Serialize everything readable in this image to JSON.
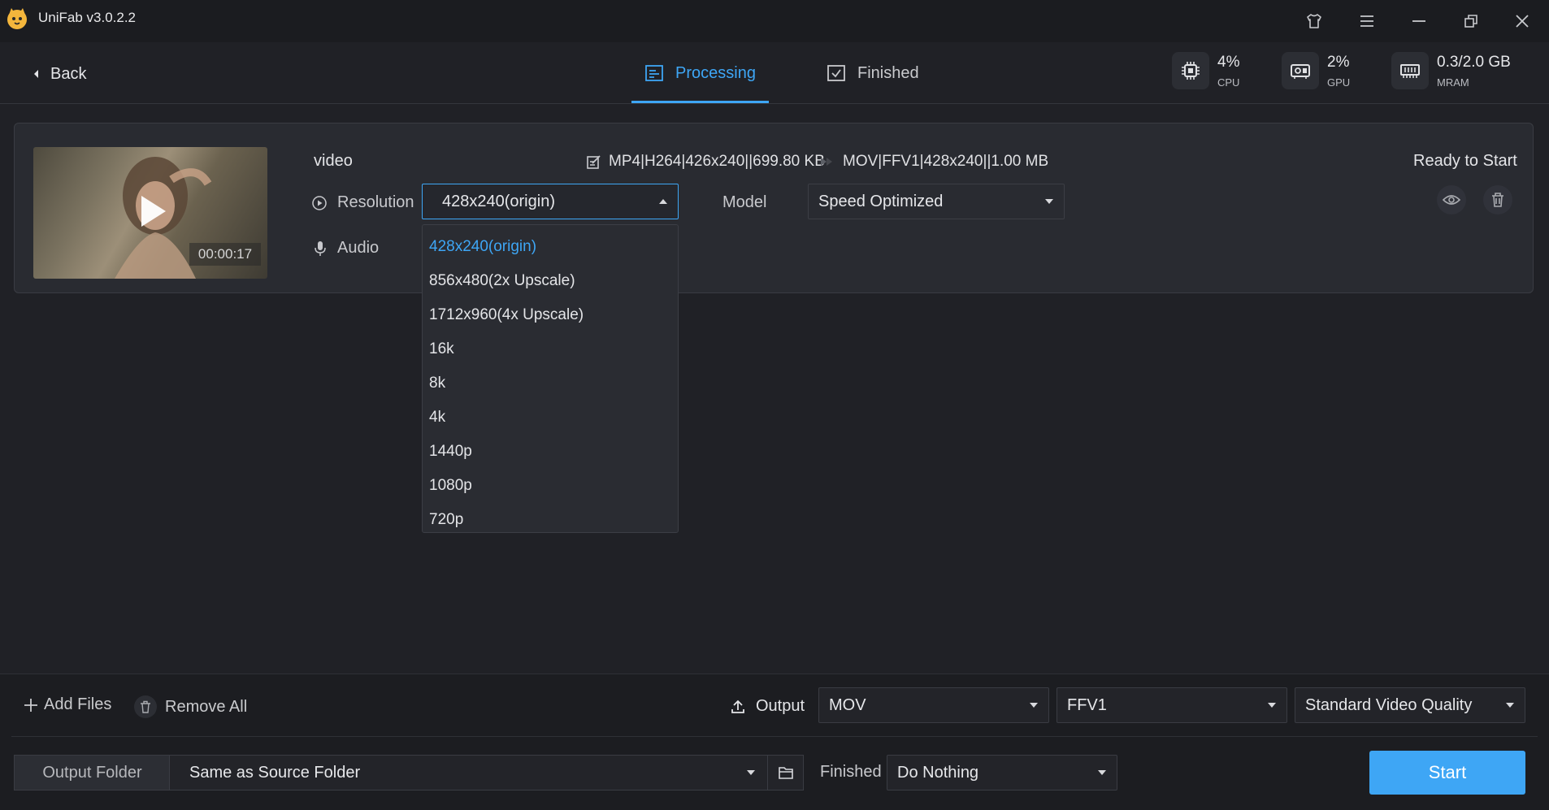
{
  "app": {
    "title": "UniFab v3.0.2.2"
  },
  "header": {
    "back_label": "Back",
    "tabs": [
      {
        "label": "Processing",
        "active": true
      },
      {
        "label": "Finished",
        "active": false
      }
    ],
    "stats": [
      {
        "icon": "cpu-icon",
        "value": "4%",
        "label": "CPU"
      },
      {
        "icon": "gpu-icon",
        "value": "2%",
        "label": "GPU"
      },
      {
        "icon": "memory-icon",
        "value": "0.3/2.0 GB",
        "label": "MRAM"
      }
    ]
  },
  "task": {
    "file_name": "video",
    "duration": "00:00:17",
    "source_info": "MP4|H264|426x240||699.80 KB",
    "target_info": "MOV|FFV1|428x240||1.00 MB",
    "status": "Ready to Start",
    "resolution_label": "Resolution",
    "resolution_value": "428x240(origin)",
    "audio_label": "Audio",
    "model_label": "Model",
    "model_value": "Speed Optimized"
  },
  "resolution_options": [
    "428x240(origin)",
    "856x480(2x Upscale)",
    "1712x960(4x Upscale)",
    "16k",
    "8k",
    "4k",
    "1440p",
    "1080p",
    "720p"
  ],
  "bottom": {
    "add_files": "Add Files",
    "remove_all": "Remove All",
    "output_label": "Output",
    "format": "MOV",
    "codec": "FFV1",
    "quality": "Standard Video Quality",
    "output_folder_label": "Output Folder",
    "output_folder_value": "Same as Source Folder",
    "finished_label": "Finished",
    "finished_action": "Do Nothing",
    "start_label": "Start"
  },
  "colors": {
    "accent": "#3ea6f5",
    "background": "#202126",
    "panel": "#292b31"
  }
}
